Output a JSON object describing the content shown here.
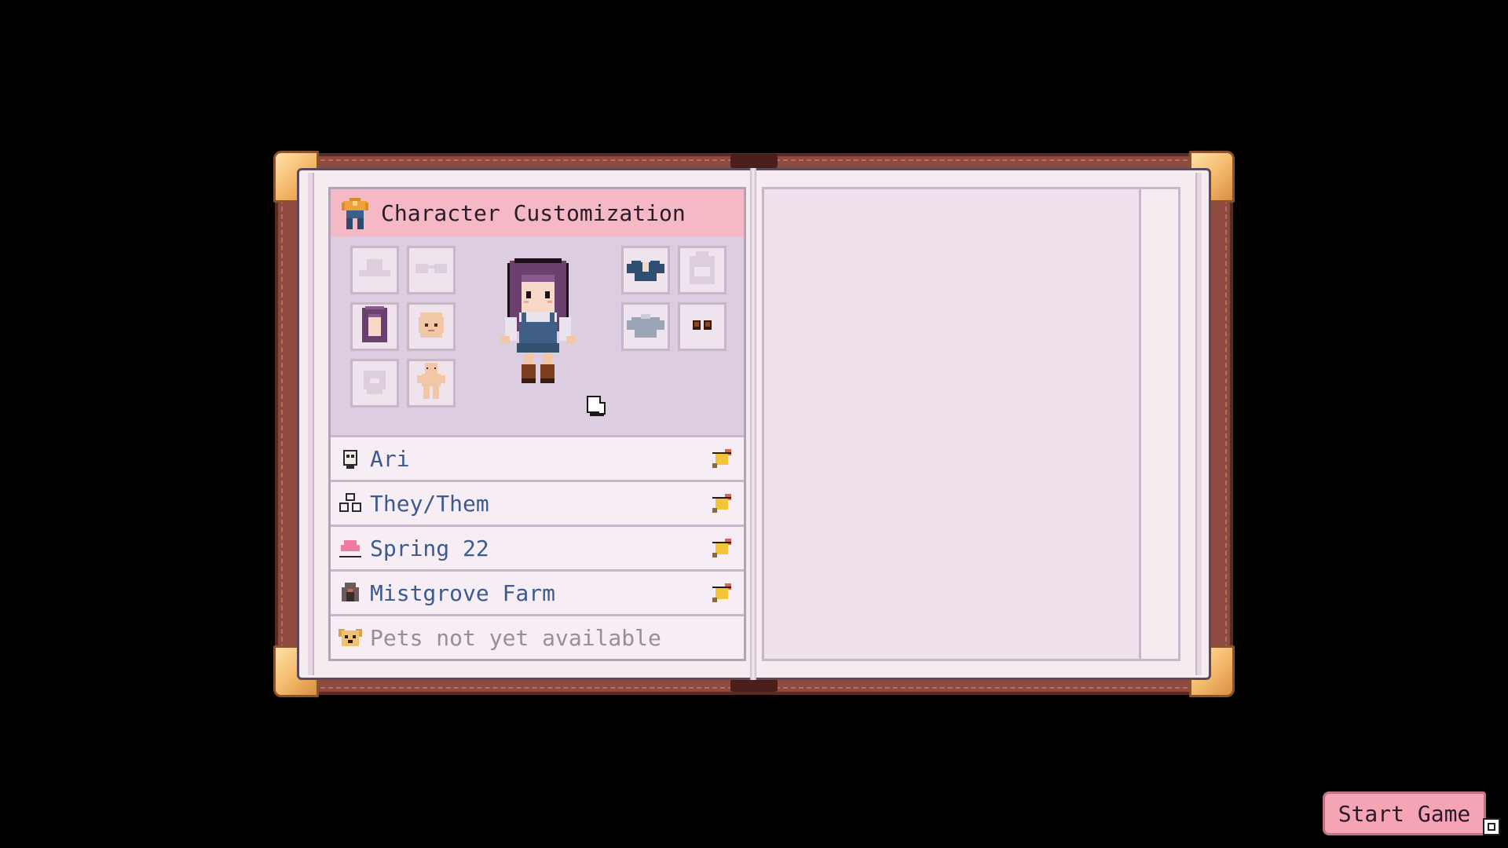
{
  "header": {
    "title": "Character Customization",
    "icon": "shirt-icon"
  },
  "slots_left": [
    {
      "id": "hat",
      "icon": "hat-icon",
      "filled": false
    },
    {
      "id": "glasses",
      "icon": "glasses-icon",
      "filled": false
    },
    {
      "id": "hair",
      "icon": "hair-icon",
      "filled": true
    },
    {
      "id": "face",
      "icon": "face-icon",
      "filled": true
    },
    {
      "id": "beard",
      "icon": "beard-icon",
      "filled": false
    },
    {
      "id": "body",
      "icon": "body-icon",
      "filled": true
    }
  ],
  "slots_right": [
    {
      "id": "top",
      "icon": "shirt-icon",
      "filled": true
    },
    {
      "id": "backpack",
      "icon": "backpack-icon",
      "filled": false
    },
    {
      "id": "outerwear",
      "icon": "outer-shirt-icon",
      "filled": true
    },
    {
      "id": "shoes",
      "icon": "shoes-icon",
      "filled": true
    }
  ],
  "info": [
    {
      "icon": "smiley-icon",
      "text": "Ari",
      "editable": true
    },
    {
      "icon": "pronouns-icon",
      "text": "They/Them",
      "editable": true
    },
    {
      "icon": "cake-icon",
      "text": "Spring 22",
      "editable": true
    },
    {
      "icon": "barn-icon",
      "text": "Mistgrove Farm",
      "editable": true
    },
    {
      "icon": "pet-icon",
      "text": "Pets not yet available",
      "editable": false
    }
  ],
  "start_button": {
    "label": "Start Game"
  },
  "colors": {
    "header_bg": "#f5b9c5",
    "row_text": "#3d5a8e",
    "disabled_text": "#9a8c9a",
    "book_cover": "#8e4a3e"
  }
}
